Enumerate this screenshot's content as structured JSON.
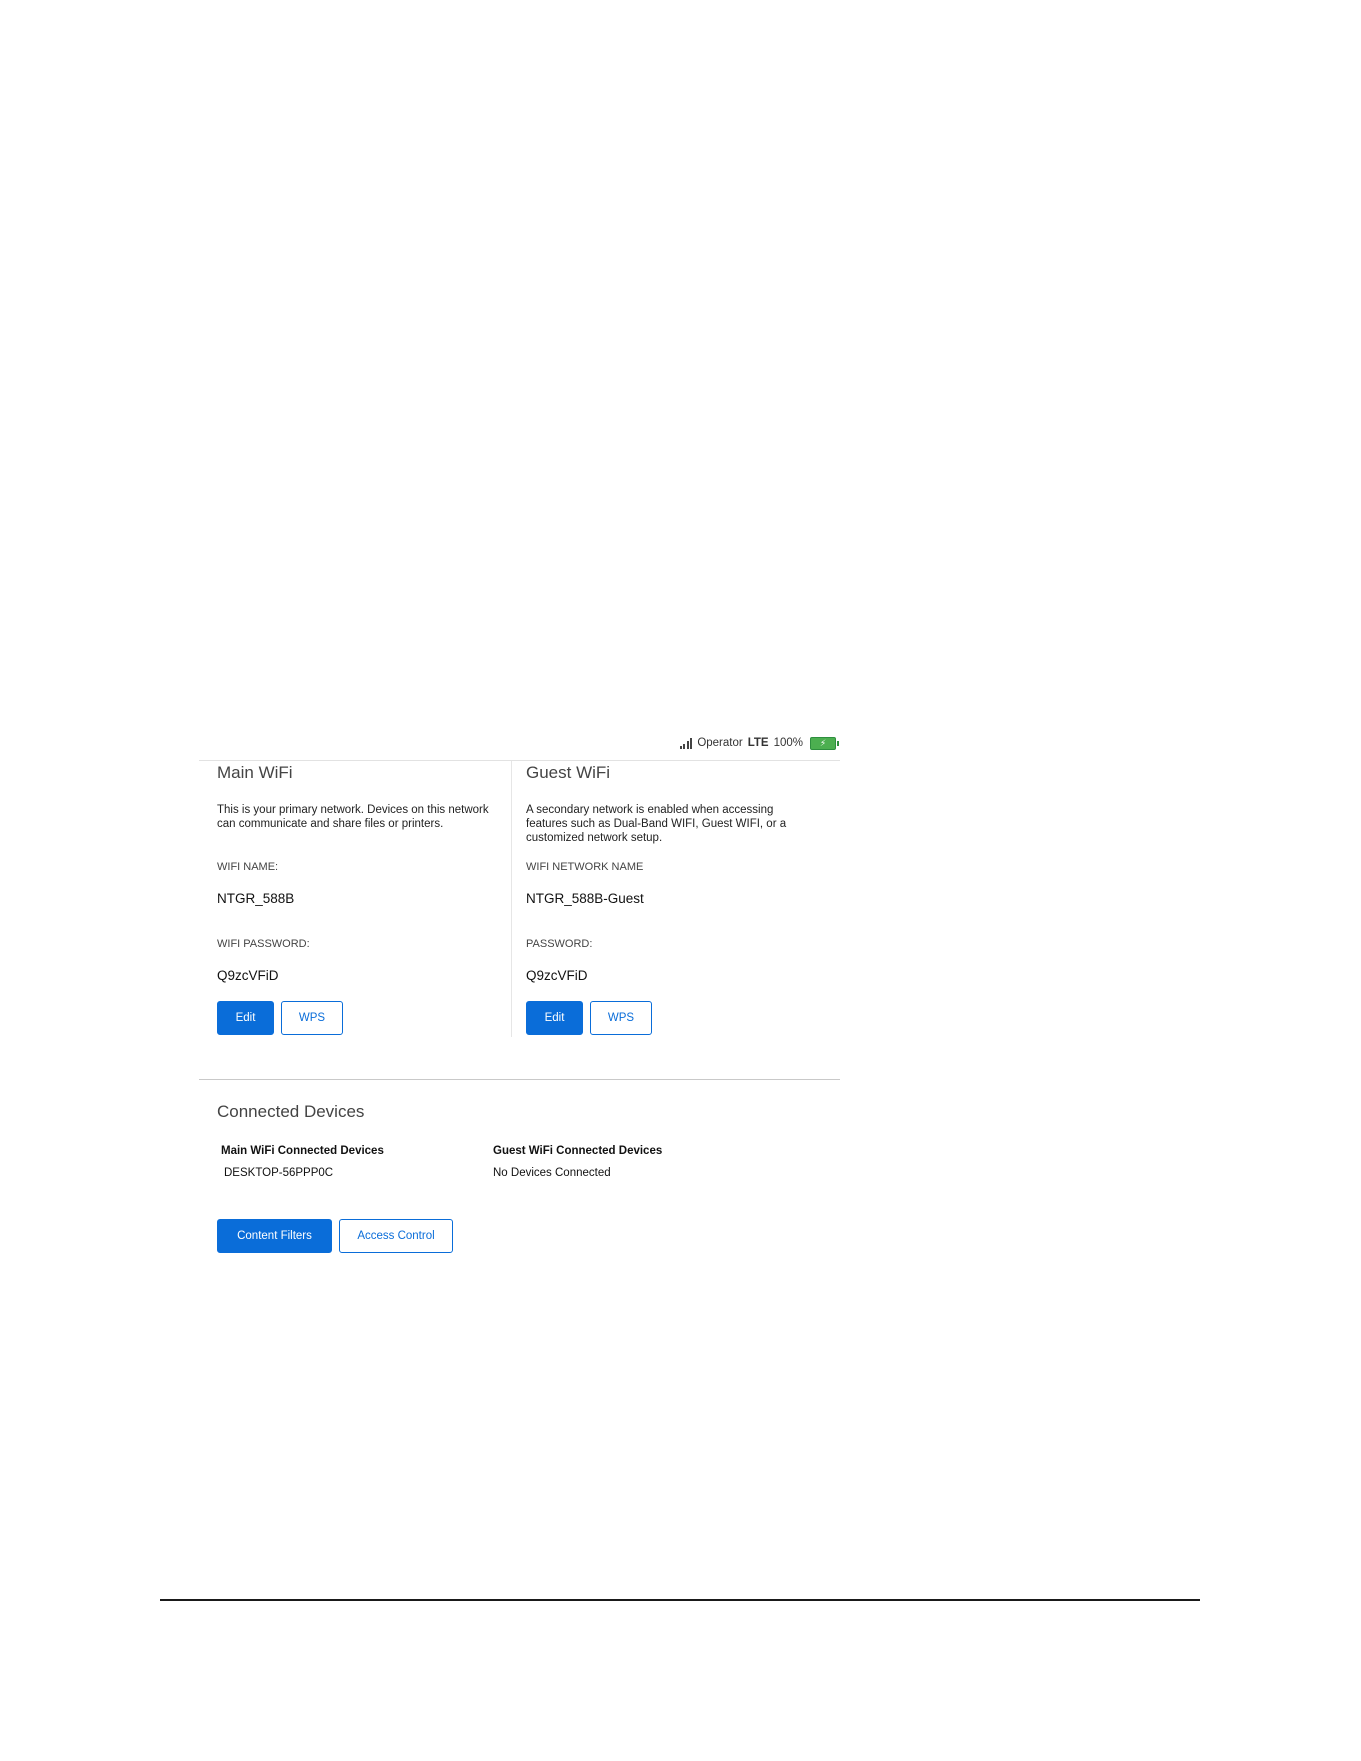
{
  "status_bar": {
    "carrier": "Operator",
    "network": "LTE",
    "battery": "100%",
    "icons": [
      "signal-icon",
      "battery-icon"
    ]
  },
  "main_wifi": {
    "title": "Main WiFi",
    "description": "This is your primary network. Devices on this network can communicate and share files or printers.",
    "name_label": "WIFI NAME:",
    "name_value": "NTGR_588B",
    "password_label": "WIFI PASSWORD:",
    "password_value": "Q9zcVFiD",
    "edit_label": "Edit",
    "wps_label": "WPS"
  },
  "guest_wifi": {
    "title": "Guest WiFi",
    "description": "A secondary network is enabled when accessing features such as Dual-Band WIFI, Guest WIFI, or a customized network setup.",
    "name_label": "WIFI NETWORK NAME",
    "name_value": "NTGR_588B-Guest",
    "password_label": "PASSWORD:",
    "password_value": "Q9zcVFiD",
    "edit_label": "Edit",
    "wps_label": "WPS"
  },
  "connected_devices": {
    "title": "Connected Devices",
    "main_header": "Main WiFi Connected Devices",
    "main_devices": [
      "DESKTOP-56PPP0C"
    ],
    "guest_header": "Guest WiFi Connected Devices",
    "guest_devices": [
      "No Devices Connected"
    ],
    "content_filters_label": "Content Filters",
    "access_control_label": "Access Control"
  },
  "colors": {
    "accent": "#0a6dd9",
    "battery": "#4caf50"
  }
}
